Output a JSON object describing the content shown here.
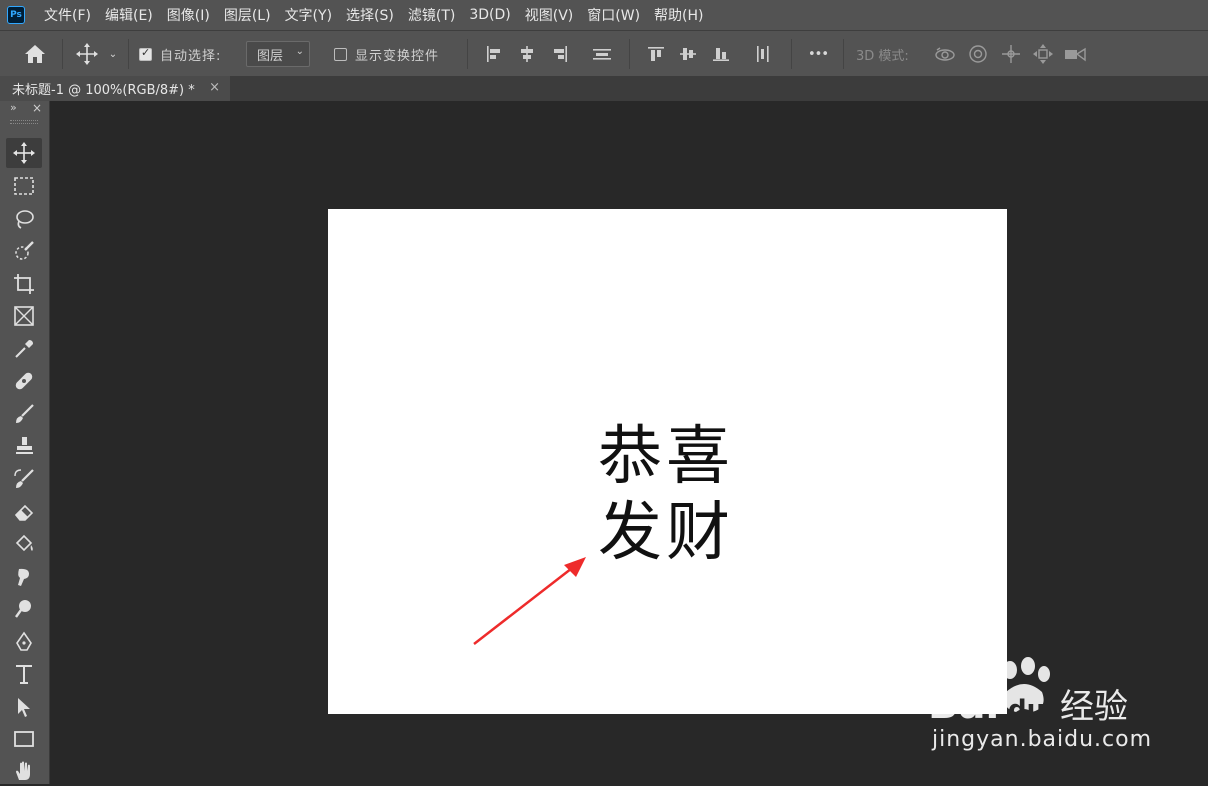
{
  "app": {
    "logo": "Ps"
  },
  "menu": [
    "文件(F)",
    "编辑(E)",
    "图像(I)",
    "图层(L)",
    "文字(Y)",
    "选择(S)",
    "滤镜(T)",
    "3D(D)",
    "视图(V)",
    "窗口(W)",
    "帮助(H)"
  ],
  "options": {
    "auto_select_label": "自动选择:",
    "auto_select_checked": true,
    "auto_select_target": "图层",
    "show_transform_label": "显示变换控件",
    "show_transform_checked": false,
    "mode_3d_label": "3D 模式:",
    "more_glyph": "•••"
  },
  "document": {
    "tab_title": "未标题-1 @ 100%(RGB/8#) *",
    "tab_close": "×"
  },
  "toolbar_top": {
    "expand": "»",
    "close": "×"
  },
  "canvas": {
    "line1": "恭喜",
    "line2": "发财",
    "background": "#ffffff",
    "arrow_color": "#ee2b2b"
  },
  "watermark": {
    "brand": "Bai",
    "brand2": "du",
    "service": "经验",
    "url": "jingyan.baidu.com"
  },
  "colors": {
    "menubar": "#535353",
    "workspace": "#282828",
    "accent": "#31a8ff"
  }
}
